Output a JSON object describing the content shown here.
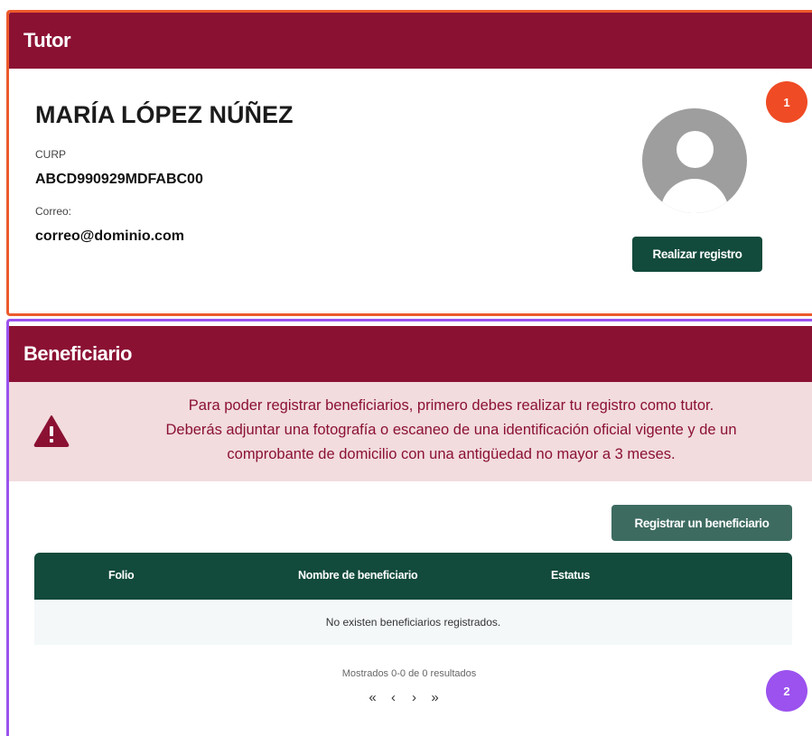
{
  "tutor": {
    "header": "Tutor",
    "name": "MARÍA LÓPEZ NÚÑEZ",
    "curp_label": "CURP",
    "curp_value": "ABCD990929MDFABC00",
    "email_label": "Correo:",
    "email_value": "correo@dominio.com",
    "avatar_icon": "user-avatar-icon",
    "register_button": "Realizar registro",
    "badge": "1",
    "badge_color": "#ef4b25"
  },
  "beneficiario": {
    "header": "Beneficiario",
    "alert_icon": "warning-icon",
    "alert_lines": [
      "Para poder registrar beneficiarios, primero debes realizar tu registro como tutor.",
      "Deberás adjuntar una fotografía o escaneo de una identificación oficial vigente y de un",
      "comprobante de domicilio con una antigüedad no mayor a 3 meses."
    ],
    "register_button": "Registrar un beneficiario",
    "table": {
      "columns": [
        "Folio",
        "Nombre de beneficiario",
        "Estatus"
      ],
      "empty_message": "No existen beneficiarios registrados."
    },
    "results_text": "Mostrados 0-0 de 0 resultados",
    "pagination": {
      "first": "«",
      "prev": "‹",
      "next": "›",
      "last": "»"
    },
    "badge": "2",
    "badge_color": "#9b52ee"
  },
  "colors": {
    "header_bg": "#8b1133",
    "primary_green": "#124a3b",
    "alert_bg": "#f2dcdd",
    "tutor_border": "#ec5a2c",
    "ben_border": "#9b52ee"
  }
}
